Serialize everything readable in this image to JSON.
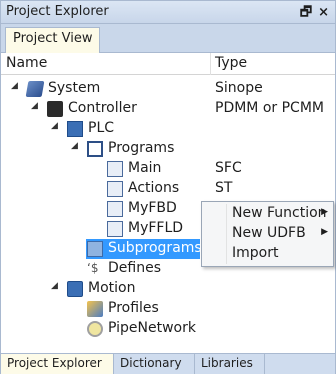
{
  "window": {
    "title": "Project Explorer",
    "pin_icon": "Б",
    "close_icon": "×"
  },
  "view_tab": {
    "label": "Project View"
  },
  "columns": {
    "name": "Name",
    "type": "Type"
  },
  "tree": {
    "system": {
      "label": "System",
      "type": "Sinope"
    },
    "controller": {
      "label": "Controller",
      "type": "PDMM or PCMM"
    },
    "plc": {
      "label": "PLC"
    },
    "programs": {
      "label": "Programs"
    },
    "main": {
      "label": "Main",
      "type": "SFC"
    },
    "actions": {
      "label": "Actions",
      "type": "ST"
    },
    "myfbd": {
      "label": "MyFBD",
      "type": "FBD"
    },
    "myffld": {
      "label": "MyFFLD"
    },
    "subprograms": {
      "label": "Subprograms"
    },
    "defines": {
      "label": "Defines"
    },
    "motion": {
      "label": "Motion"
    },
    "profiles": {
      "label": "Profiles"
    },
    "pipenetwork": {
      "label": "PipeNetwork"
    }
  },
  "context_menu": {
    "new_function": "New Function",
    "new_udfb": "New UDFB",
    "import": "Import"
  },
  "bottom_tabs": {
    "explorer": "Project Explorer",
    "dictionary": "Dictionary",
    "libraries": "Libraries"
  }
}
